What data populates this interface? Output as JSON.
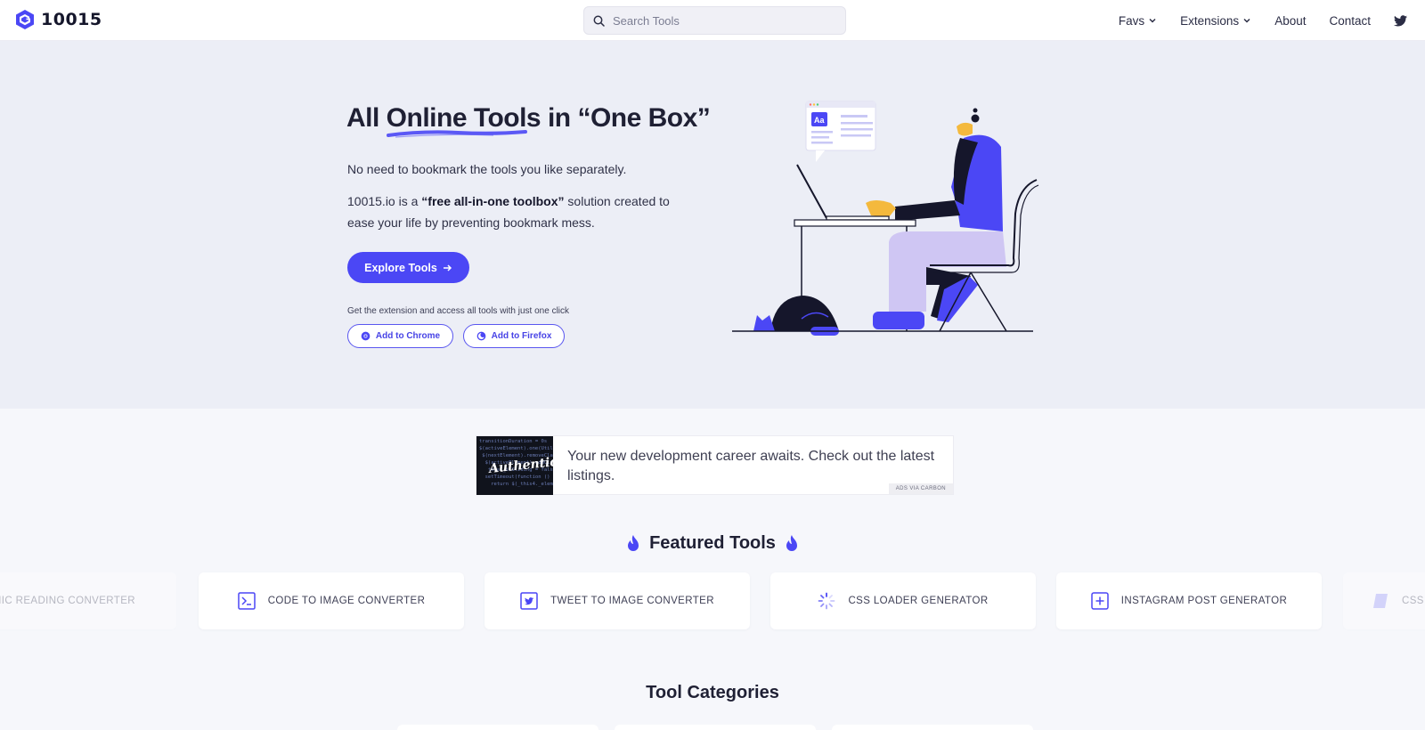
{
  "header": {
    "logo_text": "10015",
    "search_placeholder": "Search Tools",
    "nav": {
      "favs": "Favs",
      "extensions": "Extensions",
      "about": "About",
      "contact": "Contact"
    }
  },
  "hero": {
    "title_before": "All ",
    "title_highlight": "Online Tools",
    "title_after": " in “One Box”",
    "p1": "No need to bookmark the tools you like separately.",
    "p2_prefix": "10015.io is a ",
    "p2_bold": "“free all-in-one toolbox”",
    "p2_suffix": " solution created to ease your life by preventing bookmark mess.",
    "explore_label": "Explore Tools",
    "extension_text": "Get the extension and access all tools with just one click",
    "chrome_label": "Add to Chrome",
    "firefox_label": "Add to Firefox"
  },
  "ad": {
    "text": "Your new development career awaits. Check out the latest listings.",
    "image_word": "Authentic",
    "tag": "ADS VIA CARBON"
  },
  "featured": {
    "title": "Featured Tools",
    "cards": [
      {
        "label": "NIC READING CONVERTER",
        "icon": "bionic-icon"
      },
      {
        "label": "CODE TO IMAGE CONVERTER",
        "icon": "terminal-icon"
      },
      {
        "label": "TWEET TO IMAGE CONVERTER",
        "icon": "twitter-icon"
      },
      {
        "label": "CSS LOADER GENERATOR",
        "icon": "loader-icon"
      },
      {
        "label": "INSTAGRAM POST GENERATOR",
        "icon": "plus-square-icon"
      },
      {
        "label": "CSS",
        "icon": "css-icon"
      }
    ]
  },
  "categories": {
    "title": "Tool Categories"
  },
  "colors": {
    "accent": "#4b47f5",
    "hero_bg": "#eceef6",
    "page_bg": "#f6f7fb"
  }
}
